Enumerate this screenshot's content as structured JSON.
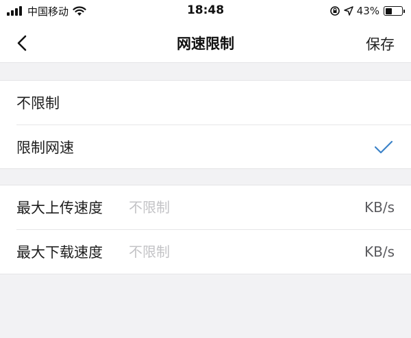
{
  "status_bar": {
    "carrier": "中国移动",
    "time": "18:48",
    "battery": "43%",
    "battery_level": 0.43
  },
  "nav": {
    "title": "网速限制",
    "save_label": "保存"
  },
  "options": [
    {
      "label": "不限制",
      "selected": false
    },
    {
      "label": "限制网速",
      "selected": true
    }
  ],
  "limits": {
    "upload": {
      "label": "最大上传速度",
      "placeholder": "不限制",
      "unit": "KB/s"
    },
    "download": {
      "label": "最大下载速度",
      "placeholder": "不限制",
      "unit": "KB/s"
    }
  },
  "colors": {
    "accent": "#3b82c8",
    "background": "#f2f2f4",
    "placeholder": "#c3c3c6"
  },
  "icons": [
    "signal-icon",
    "wifi-icon",
    "location-lock-icon",
    "location-arrow-icon",
    "battery-icon",
    "back-chevron-icon",
    "checkmark-icon"
  ]
}
